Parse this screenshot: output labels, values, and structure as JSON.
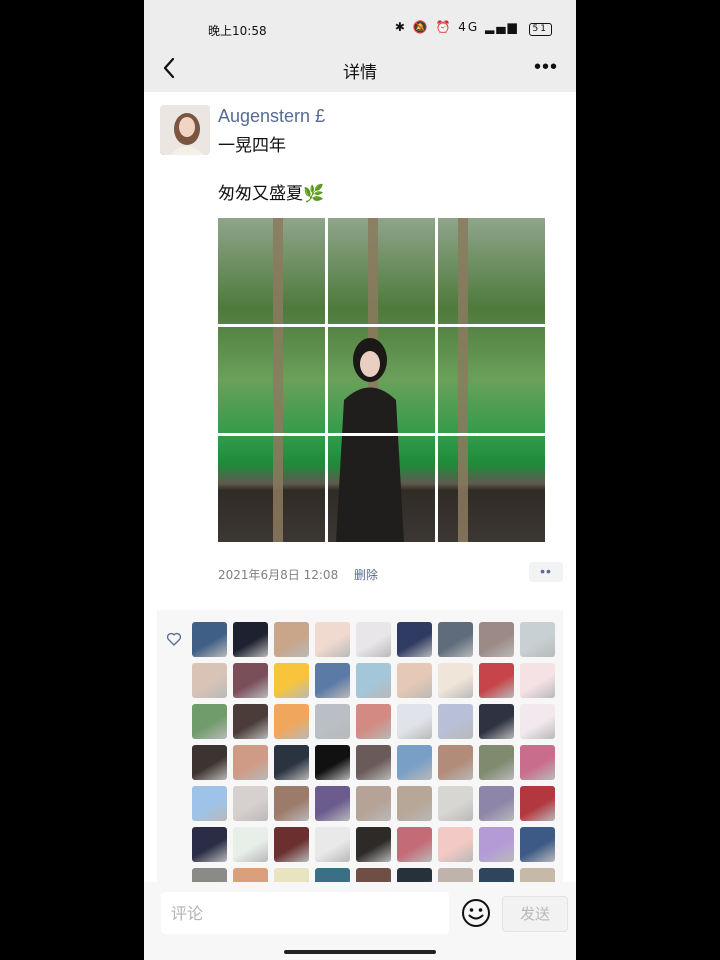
{
  "status_bar": {
    "time": "晚上10:58",
    "network": "4G",
    "battery": "51"
  },
  "nav": {
    "title": "详情"
  },
  "post": {
    "username": "Augenstern £",
    "content": "一晃四年\n\n匆匆又盛夏🌿",
    "timestamp": "2021年6月8日 12:08",
    "delete_label": "删除",
    "more_label": "••"
  },
  "likes": {
    "avatar_colors": [
      [
        "#3f5f86",
        "#1e2230",
        "#c9a58a",
        "#f0d9cf",
        "#e9e6ea",
        "#2f3b62",
        "#5e6c7b",
        "#9b8a86",
        "#c8d0d3"
      ],
      [
        "#d9c3b7",
        "#7a4f5a",
        "#f7c43b",
        "#5b7aa6",
        "#a3c6d9",
        "#e5c8b5",
        "#efe5d8",
        "#c7454a",
        "#f5e2e5"
      ],
      [
        "#6f9c6a",
        "#4b3c3a",
        "#f0a75c",
        "#b9bfc5",
        "#d38a82",
        "#e0e4ea",
        "#b7c0d6",
        "#2f3341",
        "#f2e9ee"
      ],
      [
        "#3c3430",
        "#cf9a86",
        "#2a3340",
        "#111111",
        "#6a5b5a",
        "#7a9fc6",
        "#b28b79",
        "#7f8a6f",
        "#c96d8d"
      ],
      [
        "#9dc4e8",
        "#d6d0cf",
        "#9c7b6a",
        "#6b5b8f",
        "#b4a396",
        "#b7a796",
        "#d8d6d2",
        "#8e86a8",
        "#b2373e"
      ],
      [
        "#2a2d45",
        "#e8efe9",
        "#6b2f2f",
        "#e9e9e9",
        "#2d2a28",
        "#c46b78",
        "#f2c9c5",
        "#b49bd6",
        "#3d5a86"
      ],
      [
        "#8a8a86",
        "#d9a07b",
        "#e9e4c0",
        "#3a6f86",
        "#6f4e45",
        "#27313c",
        "#c0b3ac",
        "#2f455e",
        "#c7b9a8"
      ]
    ]
  },
  "comment_box": {
    "placeholder": "评论",
    "send_label": "发送"
  }
}
